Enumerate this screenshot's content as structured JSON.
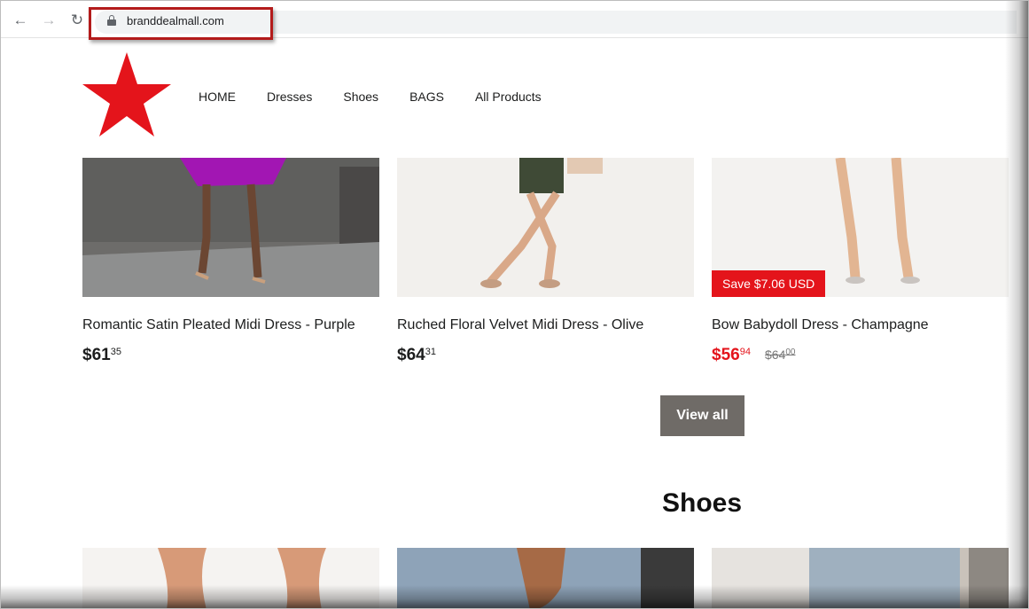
{
  "browser": {
    "url": "branddealmall.com",
    "back_icon": "arrow-left-icon",
    "forward_icon": "arrow-right-icon",
    "reload_icon": "reload-icon",
    "lock_icon": "lock-icon"
  },
  "site": {
    "logo": "red-star-logo",
    "brand_color": "#e4141b",
    "nav": [
      "HOME",
      "Dresses",
      "Shoes",
      "BAGS",
      "All Products"
    ]
  },
  "products": [
    {
      "title": "Romantic Satin Pleated Midi Dress - Purple",
      "price_main": "$61",
      "price_cents": "35"
    },
    {
      "title": "Ruched Floral Velvet Midi Dress - Olive",
      "price_main": "$64",
      "price_cents": "31"
    },
    {
      "title": "Bow Babydoll Dress - Champagne",
      "price_main": "$56",
      "price_cents": "94",
      "compare_main": "$64",
      "compare_cents": "00",
      "badge": "Save $7.06 USD"
    }
  ],
  "view_all_label": "View all",
  "shoes_section": {
    "title": "Shoes"
  }
}
